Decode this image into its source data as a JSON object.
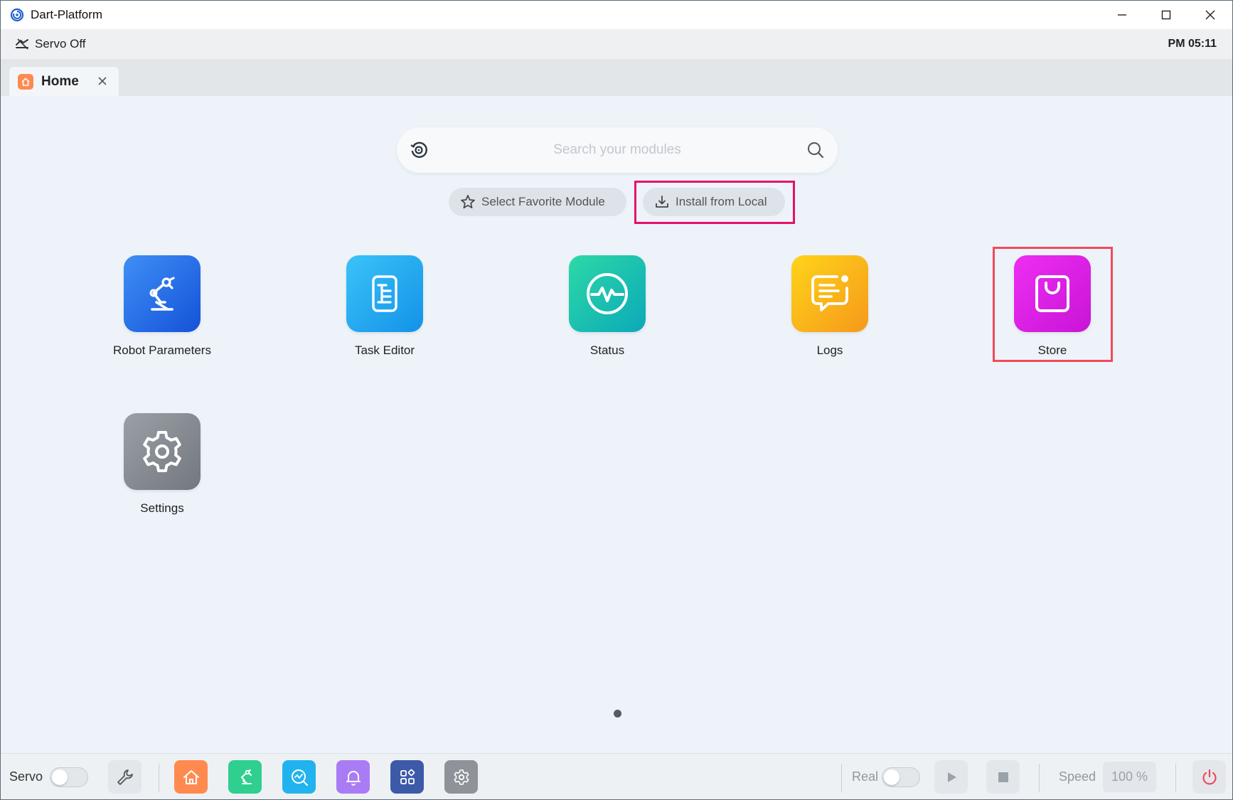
{
  "window": {
    "title": "Dart-Platform",
    "controls": [
      "minimize",
      "maximize",
      "close"
    ]
  },
  "statusbar": {
    "servo_status": "Servo Off",
    "clock": "PM 05:11"
  },
  "tabs": [
    {
      "label": "Home",
      "icon": "home-icon",
      "active": true
    }
  ],
  "search": {
    "placeholder": "Search your modules",
    "value": ""
  },
  "actions": {
    "favorite_label": "Select Favorite Module",
    "install_label": "Install from Local"
  },
  "modules": [
    {
      "label": "Robot Parameters",
      "icon": "robot-arm-icon",
      "color": "#2a6ff0"
    },
    {
      "label": "Task Editor",
      "icon": "document-list-icon",
      "color": "#22a9f0"
    },
    {
      "label": "Status",
      "icon": "pulse-icon",
      "color": "#16c0af"
    },
    {
      "label": "Logs",
      "icon": "message-icon",
      "color": "#fbb71a"
    },
    {
      "label": "Store",
      "icon": "shopping-bag-icon",
      "color": "#e021e8"
    },
    {
      "label": "Settings",
      "icon": "gear-icon",
      "color": "#868b91"
    }
  ],
  "pagination": {
    "current": 1,
    "total": 1
  },
  "bottombar": {
    "servo_label": "Servo",
    "servo_on": false,
    "real_label": "Real",
    "real_on": false,
    "speed_label": "Speed",
    "speed_value": "100 %",
    "quick_buttons": [
      {
        "icon": "wrench-icon",
        "color": "#e3e7eb"
      },
      {
        "icon": "home-icon",
        "color": "#ff8a50"
      },
      {
        "icon": "robot-arm-icon",
        "color": "#2fcf8f"
      },
      {
        "icon": "monitor-search-icon",
        "color": "#22b3ee"
      },
      {
        "icon": "bell-icon",
        "color": "#a97cf5"
      },
      {
        "icon": "apps-grid-icon",
        "color": "#3d5aa8"
      },
      {
        "icon": "gear-icon",
        "color": "#8e9399"
      }
    ]
  },
  "colors": {
    "highlight": "#e8106a",
    "main_bg": "#edf3f9",
    "power": "#f04a5a"
  }
}
